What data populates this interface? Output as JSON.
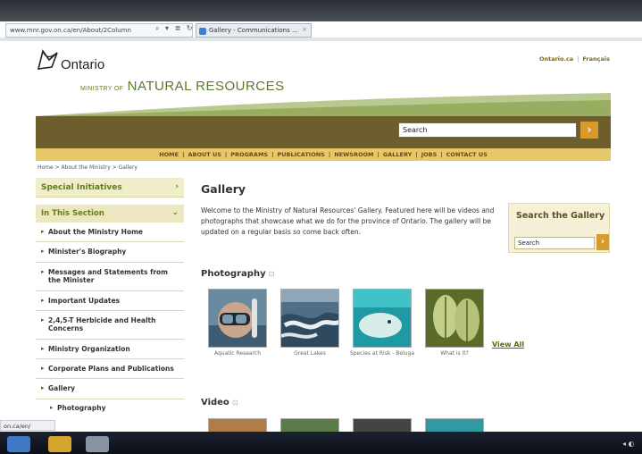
{
  "browser": {
    "address": "www.mnr.gov.on.ca/en/About/2Column",
    "address_controls": "⌕ ▾ ≣ ↻ ✕",
    "tab_title": "Gallery - Communications ...",
    "tab_close": "×"
  },
  "header": {
    "logo_text": "Ontario",
    "ministry_small": "MINISTRY OF",
    "ministry_big": "NATURAL RESOURCES",
    "link_ontario": "Ontario.ca",
    "link_separator": "|",
    "link_francais": "Français",
    "search_value": "Search",
    "search_button": "›"
  },
  "nav": [
    "HOME",
    "ABOUT US",
    "PROGRAMS",
    "PUBLICATIONS",
    "NEWSROOM",
    "GALLERY",
    "JOBS",
    "CONTACT US"
  ],
  "nav_separator": "|",
  "breadcrumb": "Home > About the Ministry > Gallery",
  "sidebar": {
    "special": "Special Initiatives",
    "special_arrow": "›",
    "section": "In This Section",
    "section_arrow": "⌄",
    "bullet": "▸",
    "items": [
      "About the Ministry Home",
      "Minister's Biography",
      "Messages and Statements from the Minister",
      "Important Updates",
      "2,4,5-T Herbicide and Health Concerns",
      "Ministry Organization",
      "Corporate Plans and Publications",
      "Gallery"
    ],
    "sub_item": "Photography"
  },
  "main": {
    "title": "Gallery",
    "intro": "Welcome to the Ministry of Natural Resources' Gallery. Featured here will be videos and photographs that showcase what we do for the province of Ontario. The gallery will be updated on a regular basis so come back often.",
    "search_gallery_title": "Search the Gallery",
    "search_gallery_value": "Search",
    "search_gallery_button": "›",
    "photography_title": "Photography",
    "photos": [
      {
        "caption": "Aquatic Research"
      },
      {
        "caption": "Great Lakes"
      },
      {
        "caption": "Species at Risk - Beluga"
      },
      {
        "caption": "What is it?"
      }
    ],
    "view_all": "View All",
    "video_title": "Video",
    "section_icon": "⊡"
  },
  "status_url": "on.ca/en/",
  "taskbar": {
    "tray": "◂ ◐"
  }
}
